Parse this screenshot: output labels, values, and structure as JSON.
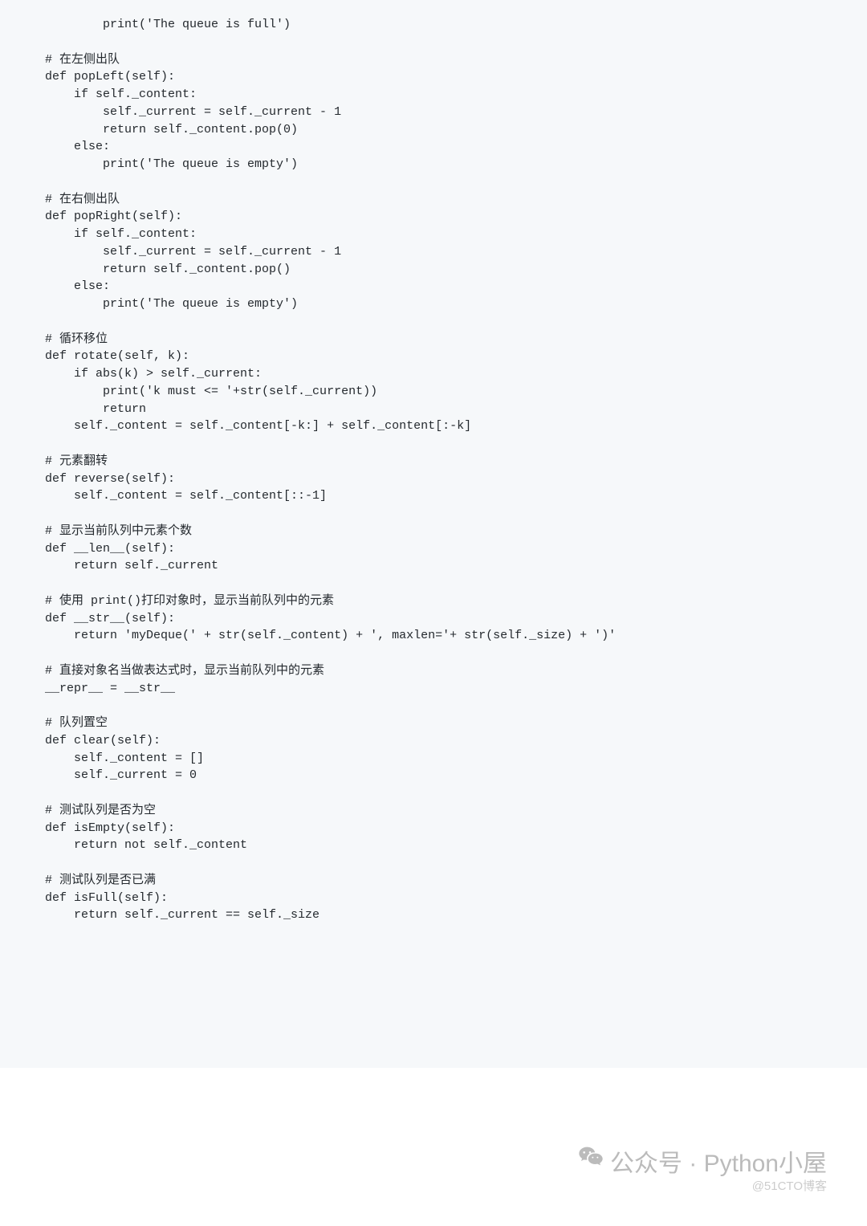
{
  "code_lines": [
    "            print('The queue is full')",
    "",
    "    # 在左侧出队",
    "    def popLeft(self):",
    "        if self._content:",
    "            self._current = self._current - 1",
    "            return self._content.pop(0)",
    "        else:",
    "            print('The queue is empty')",
    "",
    "    # 在右侧出队",
    "    def popRight(self):",
    "        if self._content:",
    "            self._current = self._current - 1",
    "            return self._content.pop()",
    "        else:",
    "            print('The queue is empty')",
    "",
    "    # 循环移位",
    "    def rotate(self, k):",
    "        if abs(k) > self._current:",
    "            print('k must <= '+str(self._current))",
    "            return",
    "        self._content = self._content[-k:] + self._content[:-k]",
    "",
    "    # 元素翻转",
    "    def reverse(self):",
    "        self._content = self._content[::-1]",
    "",
    "    # 显示当前队列中元素个数",
    "    def __len__(self):",
    "        return self._current",
    "",
    "    # 使用 print()打印对象时，显示当前队列中的元素",
    "    def __str__(self):",
    "        return 'myDeque(' + str(self._content) + ', maxlen='+ str(self._size) + ')'",
    "",
    "    # 直接对象名当做表达式时，显示当前队列中的元素",
    "    __repr__ = __str__",
    "",
    "    # 队列置空",
    "    def clear(self):",
    "        self._content = []",
    "        self._current = 0",
    "",
    "    # 测试队列是否为空",
    "    def isEmpty(self):",
    "        return not self._content",
    "",
    "    # 测试队列是否已满",
    "    def isFull(self):",
    "        return self._current == self._size"
  ],
  "watermark": {
    "line1": "公众号 · Python小屋",
    "line2": "@51CTO博客"
  }
}
